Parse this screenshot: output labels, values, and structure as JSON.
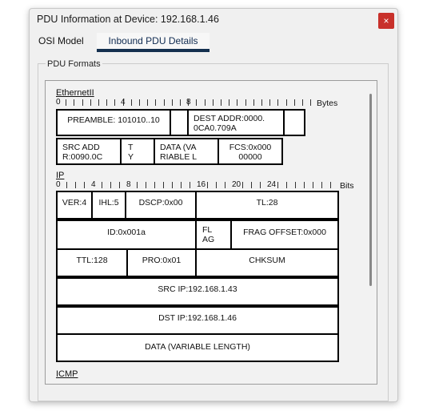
{
  "window": {
    "title": "PDU Information at Device: 192.168.1.46",
    "close_glyph": "×"
  },
  "tabs": [
    {
      "label": "OSI Model"
    },
    {
      "label": "Inbound PDU Details"
    }
  ],
  "formats_label": "PDU Formats",
  "ethernet": {
    "title": "EthernetII",
    "ruler": [
      "0",
      "4",
      "8"
    ],
    "unit": "Bytes",
    "fields": {
      "preamble": "PREAMBLE: 101010..10",
      "dest": "DEST ADDR:0000.\n0CA0.709A",
      "src": "SRC ADD\nR:0090.0C",
      "type": "T\nY",
      "data": "DATA (VA\nRIABLE L",
      "fcs": "FCS:0x000\n00000"
    }
  },
  "ip": {
    "title": "IP",
    "ruler": [
      "0",
      "4",
      "8",
      "16",
      "20",
      "24"
    ],
    "unit": "Bits",
    "fields": {
      "ver": "VER:4",
      "ihl": "IHL:5",
      "dscp": "DSCP:0x00",
      "tl": "TL:28",
      "id": "ID:0x001a",
      "flag": "FL\nAG",
      "frag": "FRAG OFFSET:0x000",
      "ttl": "TTL:128",
      "pro": "PRO:0x01",
      "chksum": "CHKSUM",
      "src": "SRC IP:192.168.1.43",
      "dst": "DST IP:192.168.1.46",
      "data": "DATA (VARIABLE LENGTH)"
    }
  },
  "icmp": {
    "title": "ICMP"
  }
}
